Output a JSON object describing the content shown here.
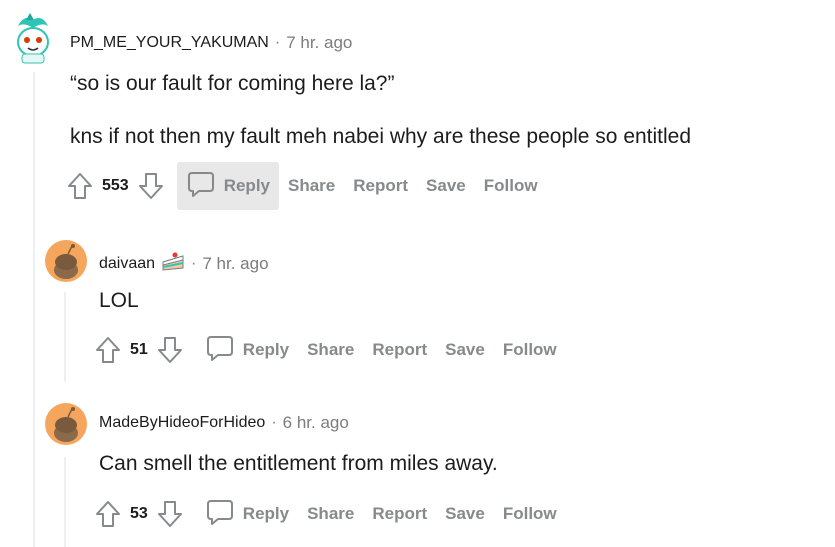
{
  "comments": [
    {
      "author": "PM_ME_YOUR_YAKUMAN",
      "separator": "·",
      "time": "7 hr. ago",
      "lines": [
        "“so is our fault for coming here la?”",
        "kns if not then my fault meh nabei why are these people so entitled"
      ],
      "score": "553"
    },
    {
      "author": "daivaan",
      "separator": "·",
      "time": "7 hr. ago",
      "lines": [
        "LOL"
      ],
      "score": "51"
    },
    {
      "author": "MadeByHideoForHideo",
      "separator": "·",
      "time": "6 hr. ago",
      "lines": [
        "Can smell the entitlement from miles away."
      ],
      "score": "53"
    }
  ],
  "actions": {
    "reply": "Reply",
    "share": "Share",
    "report": "Report",
    "save": "Save",
    "follow": "Follow"
  },
  "icons": {
    "upvote": "arrow-up-icon",
    "downvote": "arrow-down-icon",
    "reply": "speech-bubble-icon",
    "flair": "cake-icon"
  },
  "colors": {
    "avatar_orange": "#f6a65c",
    "avatar_teal": "#2ec4b6",
    "meta_gray": "#7c7c7c",
    "action_gray": "#878a8c",
    "hover_bg": "#e8e8e8"
  }
}
